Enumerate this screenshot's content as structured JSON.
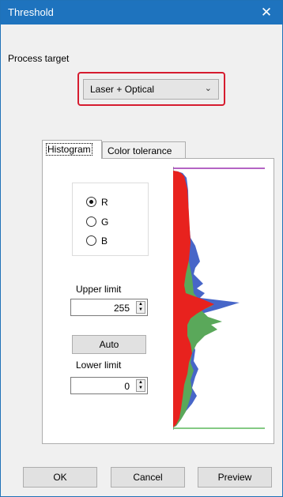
{
  "window": {
    "title": "Threshold",
    "close_glyph": "✕"
  },
  "process_target": {
    "label": "Process target",
    "selected": "Laser + Optical"
  },
  "tabs": [
    {
      "label": "Histogram",
      "active": true
    },
    {
      "label": "Color tolerance",
      "active": false
    }
  ],
  "channel": {
    "options": [
      "R",
      "G",
      "B"
    ],
    "selected": "R"
  },
  "upper_limit": {
    "label": "Upper limit",
    "value": "255"
  },
  "auto_button": "Auto",
  "lower_limit": {
    "label": "Lower limit",
    "value": "0"
  },
  "buttons": {
    "ok": "OK",
    "cancel": "Cancel",
    "preview": "Preview"
  },
  "histogram": {
    "upper_marker_color": "#9b30b0",
    "lower_marker_color": "#5cb85c",
    "series_colors": {
      "R": "#e8221e",
      "G": "#5aa85a",
      "B": "#4766c8"
    }
  }
}
